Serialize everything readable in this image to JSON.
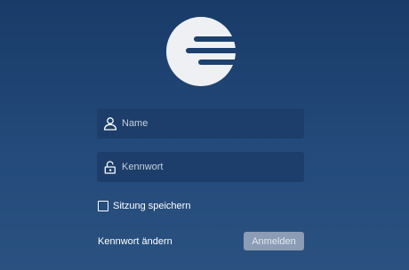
{
  "login": {
    "name_placeholder": "Name",
    "name_value": "",
    "password_placeholder": "Kennwort",
    "password_value": "",
    "remember_label": "Sitzung speichern",
    "remember_checked": false,
    "change_password_label": "Kennwort ändern",
    "submit_label": "Anmelden"
  },
  "icons": {
    "logo": "brand-logo",
    "name_field": "user-icon",
    "password_field": "lock-icon"
  },
  "colors": {
    "background_top": "#193b68",
    "background_bottom": "#2a5180",
    "field_background": "#1d3e6a",
    "button_background": "#8b9cb4",
    "logo_color": "#eef0f4"
  }
}
